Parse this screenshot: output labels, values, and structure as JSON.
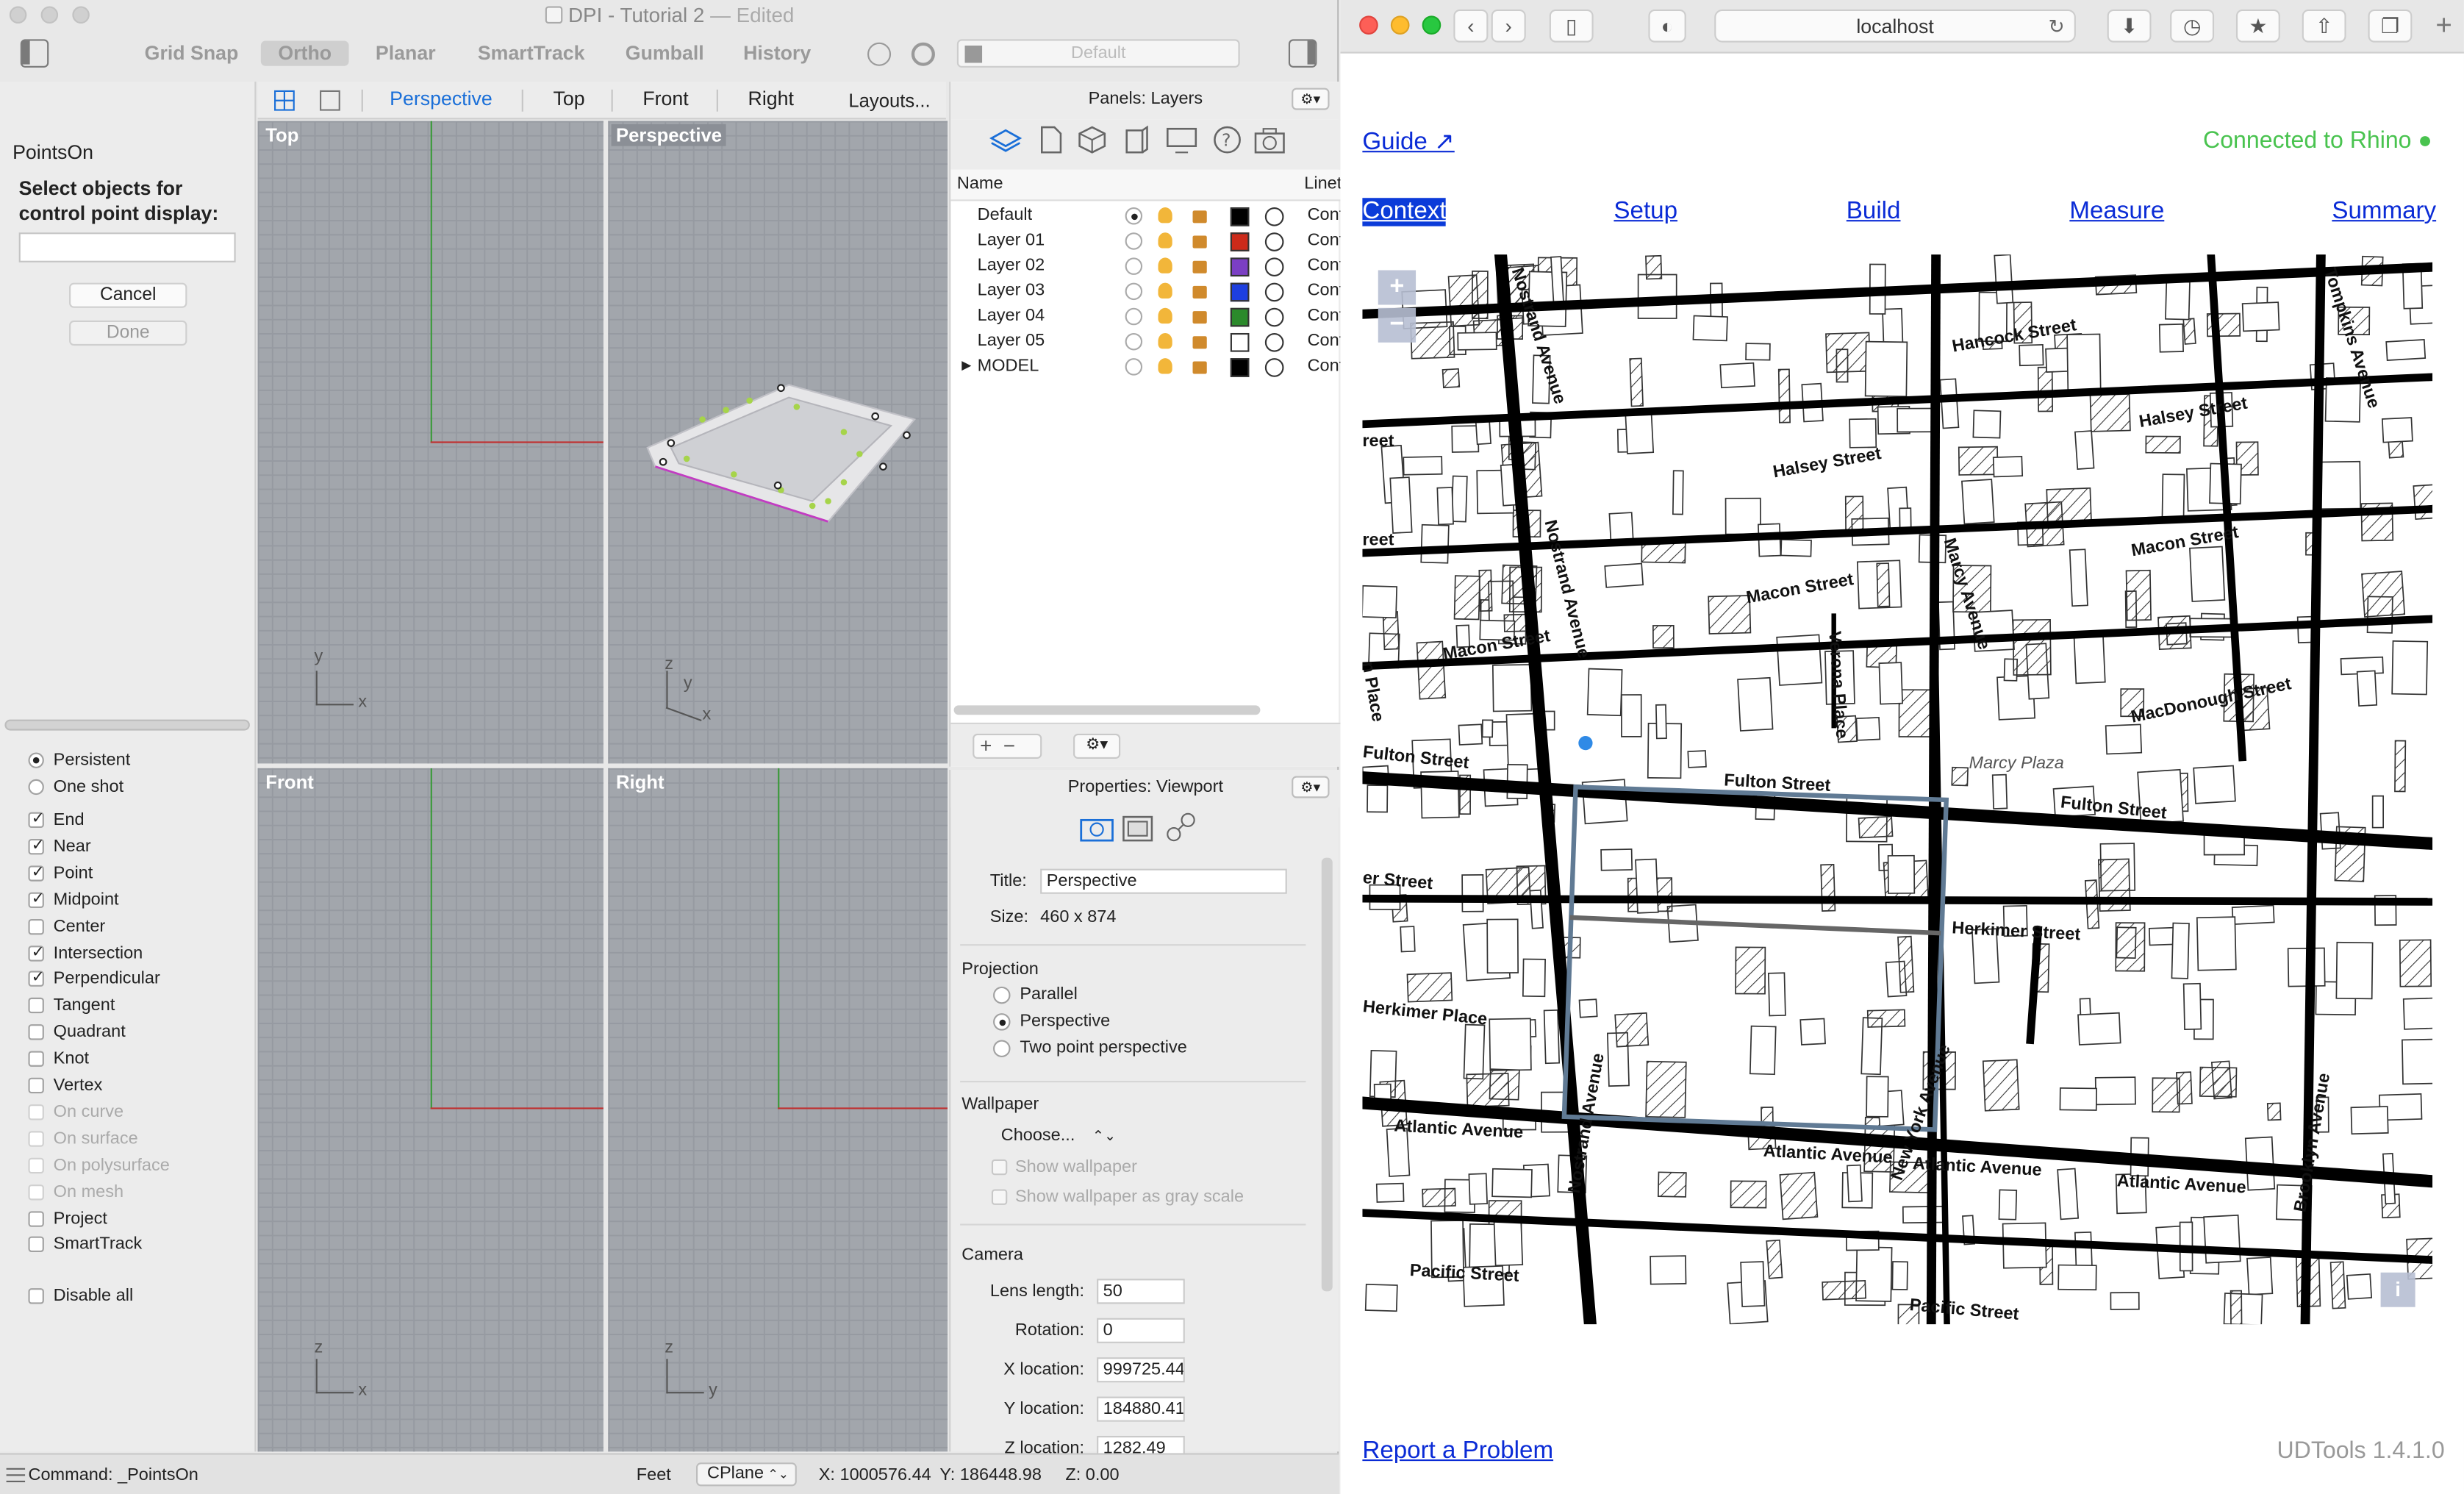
{
  "rhino": {
    "title": "DPI - Tutorial 2",
    "title_suffix": "— Edited",
    "toolbar": [
      "Grid Snap",
      "Ortho",
      "Planar",
      "SmartTrack",
      "Gumball",
      "History"
    ],
    "layer_dropdown": "Default",
    "viewport_tabs": [
      "Perspective",
      "Top",
      "Front",
      "Right",
      "Layouts..."
    ],
    "command": {
      "name": "PointsOn",
      "prompt": "Select objects for control point display:",
      "cancel": "Cancel",
      "done": "Done"
    },
    "osnap_mode": [
      {
        "label": "Persistent",
        "selected": true
      },
      {
        "label": "One shot",
        "selected": false
      }
    ],
    "osnaps": [
      {
        "label": "End",
        "checked": true,
        "enabled": true
      },
      {
        "label": "Near",
        "checked": true,
        "enabled": true
      },
      {
        "label": "Point",
        "checked": true,
        "enabled": true
      },
      {
        "label": "Midpoint",
        "checked": true,
        "enabled": true
      },
      {
        "label": "Center",
        "checked": false,
        "enabled": true
      },
      {
        "label": "Intersection",
        "checked": true,
        "enabled": true
      },
      {
        "label": "Perpendicular",
        "checked": true,
        "enabled": true
      },
      {
        "label": "Tangent",
        "checked": false,
        "enabled": true
      },
      {
        "label": "Quadrant",
        "checked": false,
        "enabled": true
      },
      {
        "label": "Knot",
        "checked": false,
        "enabled": true
      },
      {
        "label": "Vertex",
        "checked": false,
        "enabled": true
      },
      {
        "label": "On curve",
        "checked": false,
        "enabled": false
      },
      {
        "label": "On surface",
        "checked": false,
        "enabled": false
      },
      {
        "label": "On polysurface",
        "checked": false,
        "enabled": false
      },
      {
        "label": "On mesh",
        "checked": false,
        "enabled": false
      },
      {
        "label": "Project",
        "checked": false,
        "enabled": true
      },
      {
        "label": "SmartTrack",
        "checked": false,
        "enabled": true
      }
    ],
    "disable_all": "Disable all",
    "viewports": {
      "top": "Top",
      "perspective": "Perspective",
      "front": "Front",
      "right": "Right",
      "axes": {
        "x": "x",
        "y": "y",
        "z": "z"
      }
    },
    "layers_panel": {
      "title": "Panels: Layers",
      "col_name": "Name",
      "col_linetype": "Linet",
      "rows": [
        {
          "name": "Default",
          "current": true,
          "color": "#000000",
          "linetype": "Conti"
        },
        {
          "name": "Layer 01",
          "current": false,
          "color": "#cc2a1a",
          "linetype": "Conti"
        },
        {
          "name": "Layer 02",
          "current": false,
          "color": "#7b3fc4",
          "linetype": "Conti"
        },
        {
          "name": "Layer 03",
          "current": false,
          "color": "#1d3fe0",
          "linetype": "Conti"
        },
        {
          "name": "Layer 04",
          "current": false,
          "color": "#2b8a2b",
          "linetype": "Conti"
        },
        {
          "name": "Layer 05",
          "current": false,
          "color": "#ffffff",
          "linetype": "Conti"
        },
        {
          "name": "MODEL",
          "current": false,
          "color": "#000000",
          "linetype": "Conti"
        }
      ]
    },
    "properties": {
      "title": "Properties: Viewport",
      "title_label": "Title:",
      "title_value": "Perspective",
      "size_label": "Size:",
      "size_value": "460 x 874",
      "projection_label": "Projection",
      "projections": [
        {
          "label": "Parallel",
          "selected": false
        },
        {
          "label": "Perspective",
          "selected": true
        },
        {
          "label": "Two point perspective",
          "selected": false
        }
      ],
      "wallpaper_label": "Wallpaper",
      "wallpaper_choose": "Choose...",
      "show_wallpaper": "Show wallpaper",
      "show_gray": "Show wallpaper as gray scale",
      "camera_label": "Camera",
      "camera_fields": [
        {
          "label": "Lens length:",
          "value": "50"
        },
        {
          "label": "Rotation:",
          "value": "0"
        },
        {
          "label": "X location:",
          "value": "999725.44"
        },
        {
          "label": "Y location:",
          "value": "184880.41"
        },
        {
          "label": "Z location:",
          "value": "1282.49"
        }
      ]
    },
    "status": {
      "command": "Command: _PointsOn",
      "units": "Feet",
      "cplane": "CPlane",
      "x": "X: 1000576.44",
      "y": "Y: 186448.98",
      "z": "Z: 0.00"
    }
  },
  "safari": {
    "url": "localhost",
    "app": {
      "guide": "Guide ↗",
      "connected": "Connected to Rhino ●",
      "tabs": [
        "Context",
        "Setup",
        "Build",
        "Measure",
        "Summary"
      ],
      "active_tab": "Context",
      "report": "Report a Problem",
      "version": "UDTools 1.4.1.0"
    },
    "map": {
      "zoom_in": "+",
      "zoom_out": "−",
      "info": "i",
      "streets": [
        "Nostrand Avenue",
        "Tompkins Avenue",
        "Hancock Street",
        "Halsey Street",
        "Halsey Street",
        "Macon Street",
        "Macon Street",
        "Macon Street",
        "Marcy Avenue",
        "Verona Place",
        "MacDonough Street",
        "Fulton Street",
        "Fulton Street",
        "Fulton Street",
        "Marcy Plaza",
        "Herkimer Street",
        "Herkimer Place",
        "Atlantic Avenue",
        "Atlantic Avenue",
        "Atlantic Avenue",
        "Atlantic Avenue",
        "New York Avenue",
        "Nostrand Avenue",
        "Brooklyn Avenue",
        "Pacific Street",
        "Pacific Street",
        "Nostrand Avenue",
        "reet",
        "reet",
        "n Place",
        "er Street"
      ]
    }
  }
}
